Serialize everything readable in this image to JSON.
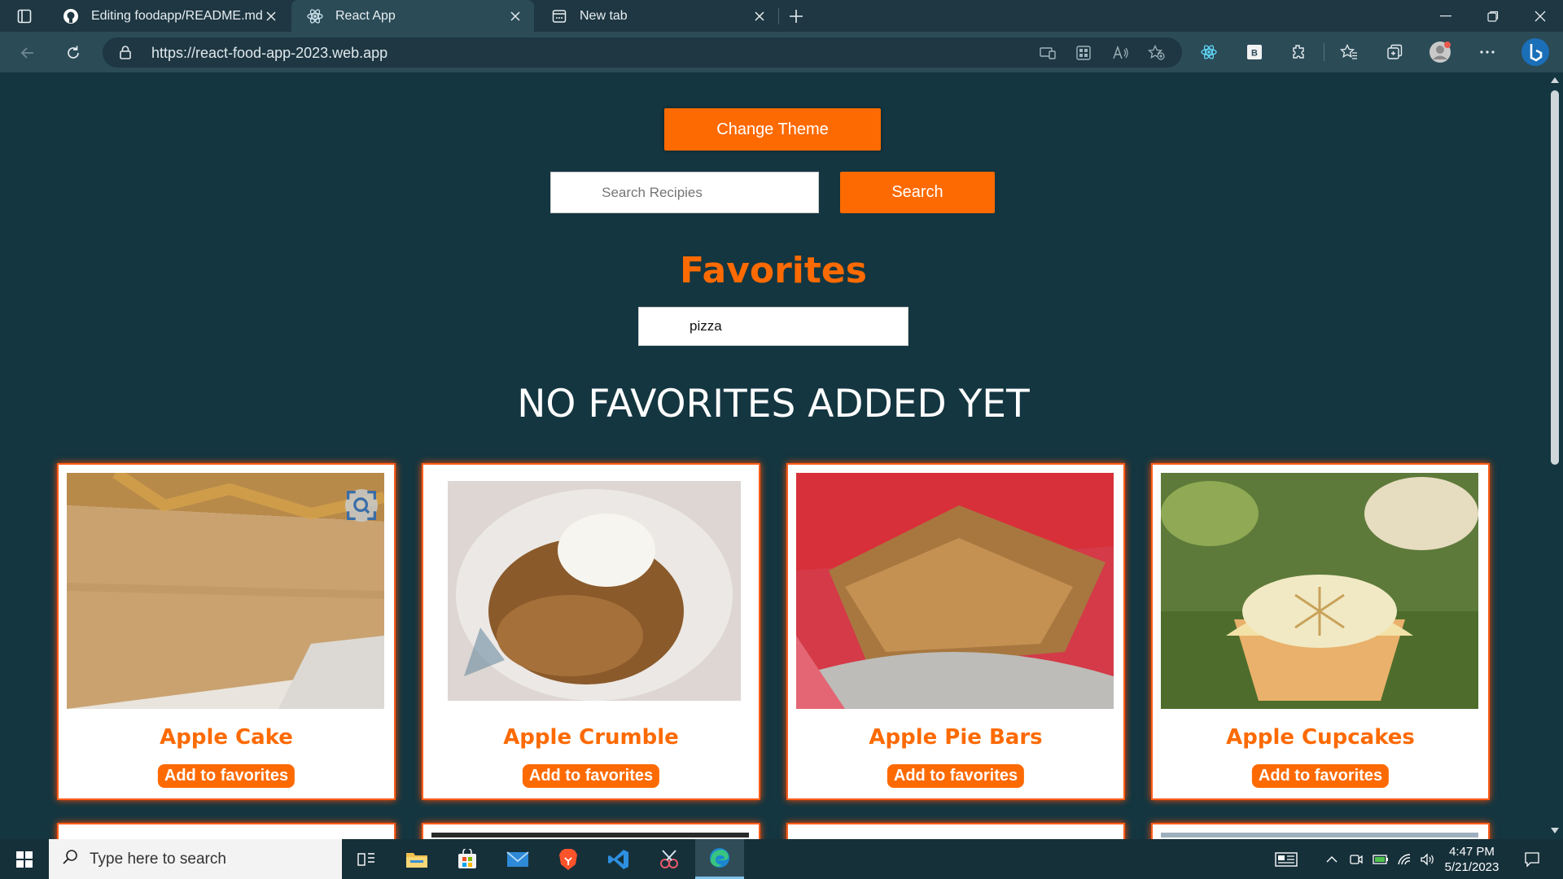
{
  "browser": {
    "tabs": [
      {
        "label": "Editing foodapp/README.md at",
        "favicon": "github-icon"
      },
      {
        "label": "React App",
        "favicon": "react-icon",
        "active": true
      },
      {
        "label": "New tab",
        "favicon": "newtab-icon"
      }
    ],
    "url": "https://react-food-app-2023.web.app"
  },
  "page": {
    "theme_button": "Change Theme",
    "search_placeholder": "Search Recipies",
    "search_button": "Search",
    "favorites_title": "Favorites",
    "favorites_filter_value": "pizza",
    "empty_message": "NO FAVORITES ADDED YET",
    "recipes": [
      {
        "name": "Apple Cake",
        "button": "Add to favorites"
      },
      {
        "name": "Apple Crumble",
        "button": "Add to favorites"
      },
      {
        "name": "Apple Pie Bars",
        "button": "Add to favorites"
      },
      {
        "name": "Apple Cupcakes",
        "button": "Add to favorites"
      }
    ]
  },
  "taskbar": {
    "search_placeholder": "Type here to search",
    "time": "4:47 PM",
    "date": "5/21/2023"
  },
  "colors": {
    "page_bg": "#143640",
    "accent": "#fd6a02",
    "chrome_bg": "#2b4b57"
  }
}
